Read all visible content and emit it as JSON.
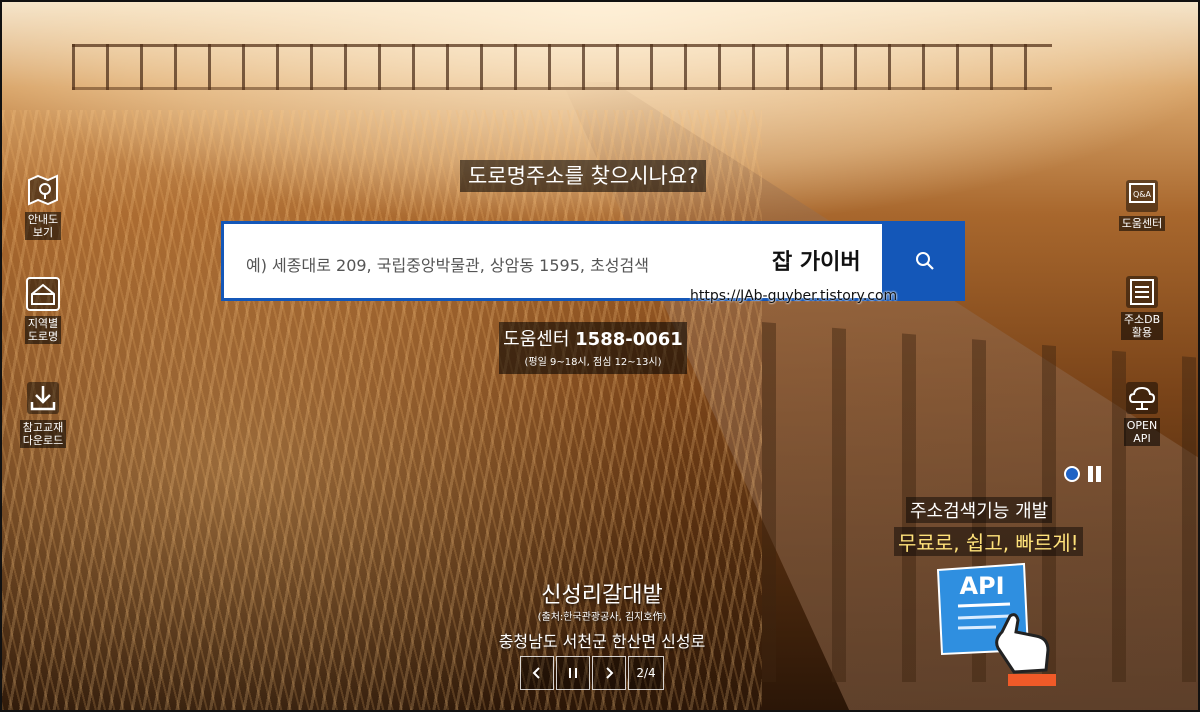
{
  "sidebar_left": [
    {
      "label": "안내도\n보기",
      "icon": "map-pin-icon"
    },
    {
      "label": "지역별\n도로명",
      "icon": "house-outline-icon"
    },
    {
      "label": "참고교재\n다운로드",
      "icon": "download-icon"
    }
  ],
  "sidebar_right": [
    {
      "label": "도움센터",
      "icon": "qa-screen-icon"
    },
    {
      "label": "주소DB\n활용",
      "icon": "list-document-icon"
    },
    {
      "label": "OPEN\nAPI",
      "icon": "cloud-network-icon"
    }
  ],
  "hero": {
    "headline": "도로명주소를 찾으시나요?",
    "search": {
      "placeholder": "예) 세종대로 209, 국립중앙박물관, 상암동 1595, 초성검색",
      "overlay_text": "잡 가이버"
    },
    "watermark_url": "https://JAb-guyber.tistory.com",
    "help_center": {
      "label": "도움센터",
      "phone": "1588-0061",
      "hours": "(평일 9~18시, 점심 12~13시)"
    }
  },
  "promo": {
    "line1": "주소검색기능 개발",
    "line2": "무료로, 쉽고, 빠르게!",
    "badge": "API"
  },
  "slide": {
    "title": "신성리갈대밭",
    "source": "(출처:한국관광공사, 김지호作)",
    "location": "충청남도 서천군 한산면 신성로",
    "counter": "2/4"
  },
  "colors": {
    "accent": "#1457b8",
    "promo_highlight": "#ffe27a"
  }
}
